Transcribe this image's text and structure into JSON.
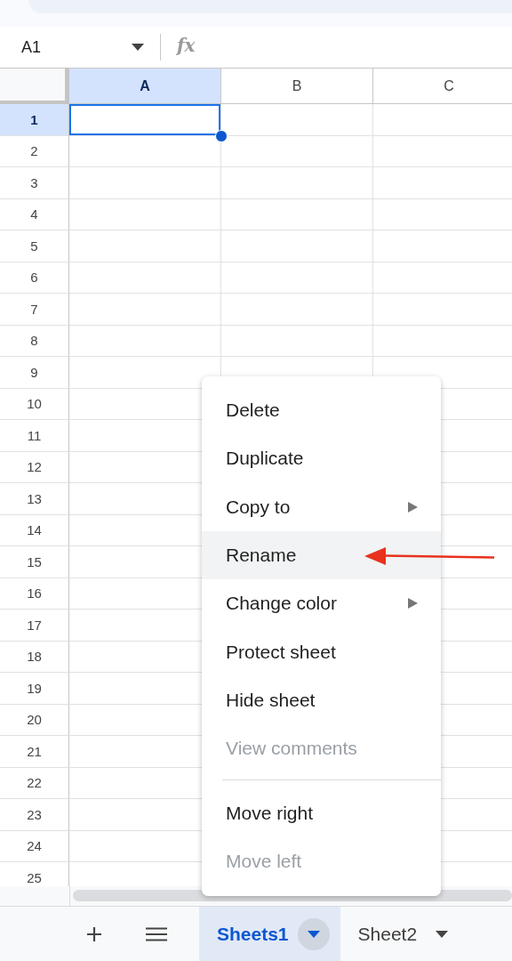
{
  "name_box": {
    "value": "A1"
  },
  "formula_bar": {
    "label": "fx"
  },
  "columns": [
    {
      "label": "A",
      "selected": true
    },
    {
      "label": "B",
      "selected": false
    },
    {
      "label": "C",
      "selected": false
    }
  ],
  "rows": [
    {
      "label": "1",
      "selected": true
    },
    {
      "label": "2",
      "selected": false
    },
    {
      "label": "3",
      "selected": false
    },
    {
      "label": "4",
      "selected": false
    },
    {
      "label": "5",
      "selected": false
    },
    {
      "label": "6",
      "selected": false
    },
    {
      "label": "7",
      "selected": false
    },
    {
      "label": "8",
      "selected": false
    },
    {
      "label": "9",
      "selected": false
    },
    {
      "label": "10",
      "selected": false
    },
    {
      "label": "11",
      "selected": false
    },
    {
      "label": "12",
      "selected": false
    },
    {
      "label": "13",
      "selected": false
    },
    {
      "label": "14",
      "selected": false
    },
    {
      "label": "15",
      "selected": false
    },
    {
      "label": "16",
      "selected": false
    },
    {
      "label": "17",
      "selected": false
    },
    {
      "label": "18",
      "selected": false
    },
    {
      "label": "19",
      "selected": false
    },
    {
      "label": "20",
      "selected": false
    },
    {
      "label": "21",
      "selected": false
    },
    {
      "label": "22",
      "selected": false
    },
    {
      "label": "23",
      "selected": false
    },
    {
      "label": "24",
      "selected": false
    },
    {
      "label": "25",
      "selected": false
    }
  ],
  "context_menu": {
    "items": [
      {
        "kind": "item",
        "label": "Delete",
        "disabled": false,
        "submenu": false,
        "selected": false
      },
      {
        "kind": "item",
        "label": "Duplicate",
        "disabled": false,
        "submenu": false,
        "selected": false
      },
      {
        "kind": "item",
        "label": "Copy to",
        "disabled": false,
        "submenu": true,
        "selected": false
      },
      {
        "kind": "item",
        "label": "Rename",
        "disabled": false,
        "submenu": false,
        "selected": true
      },
      {
        "kind": "item",
        "label": "Change color",
        "disabled": false,
        "submenu": true,
        "selected": false
      },
      {
        "kind": "item",
        "label": "Protect sheet",
        "disabled": false,
        "submenu": false,
        "selected": false
      },
      {
        "kind": "item",
        "label": "Hide sheet",
        "disabled": false,
        "submenu": false,
        "selected": false
      },
      {
        "kind": "item",
        "label": "View comments",
        "disabled": true,
        "submenu": false,
        "selected": false
      },
      {
        "kind": "separator"
      },
      {
        "kind": "item",
        "label": "Move right",
        "disabled": false,
        "submenu": false,
        "selected": false
      },
      {
        "kind": "item",
        "label": "Move left",
        "disabled": true,
        "submenu": false,
        "selected": false
      }
    ]
  },
  "annotations": [
    {
      "kind": "arrow"
    }
  ],
  "sheet_tabs": [
    {
      "label": "Sheets1",
      "selected": true
    },
    {
      "label": "Sheet2",
      "selected": false
    }
  ]
}
